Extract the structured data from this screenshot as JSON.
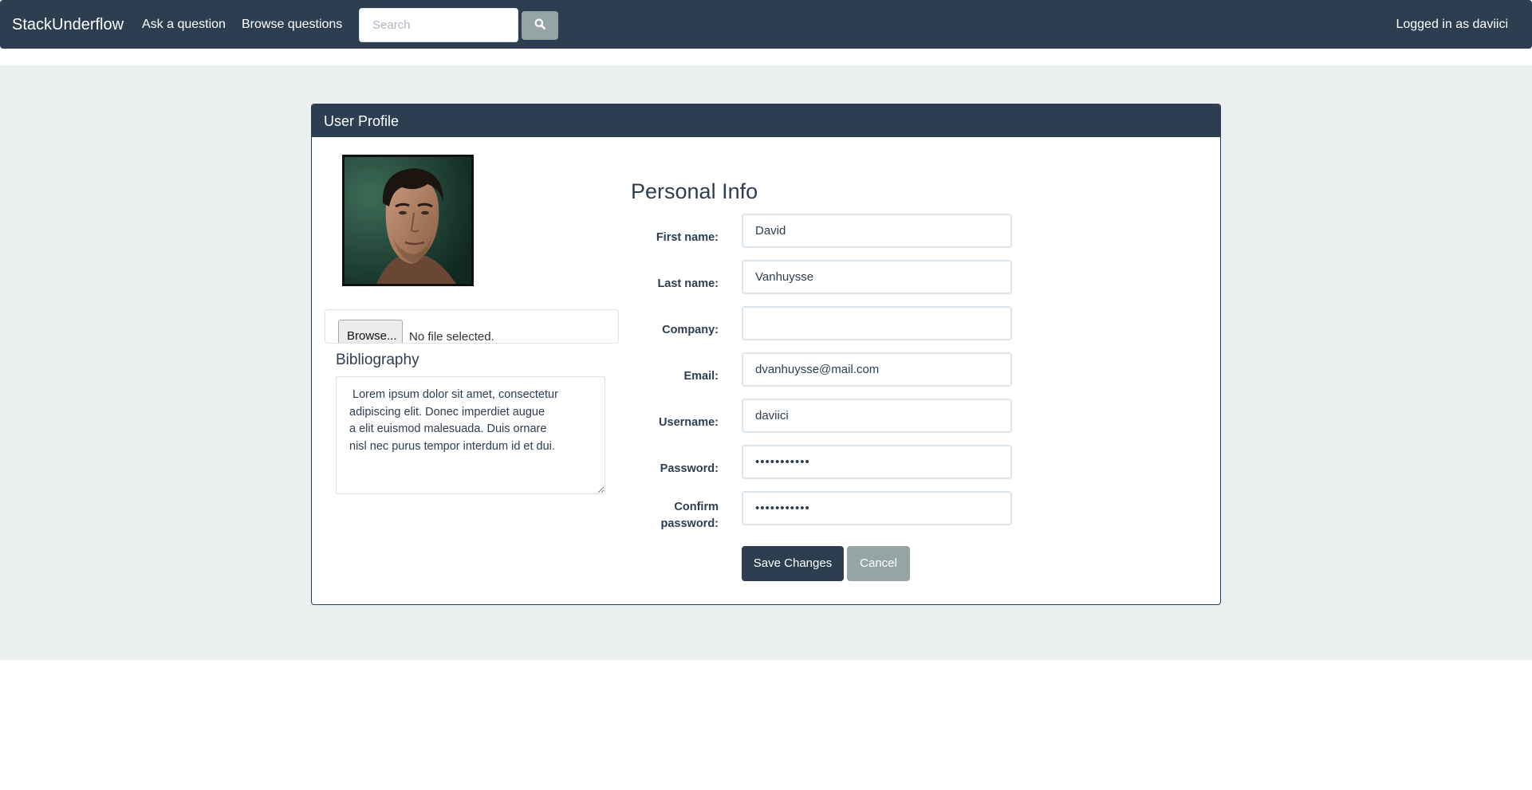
{
  "navbar": {
    "brand": "StackUnderflow",
    "ask_label": "Ask a question",
    "browse_label": "Browse questions",
    "search_placeholder": "Search",
    "search_icon": "search-icon",
    "logged_in_text": "Logged in as daviici"
  },
  "panel": {
    "title": "User Profile"
  },
  "avatar": {
    "icon": "user-avatar-photo"
  },
  "file_upload": {
    "button_label": "Browse...",
    "status": "No file selected."
  },
  "bio": {
    "label": "Bibliography",
    "text": " Lorem ipsum dolor sit amet, consectetur\nadipiscing elit. Donec imperdiet augue\na elit euismod malesuada. Duis ornare\nnisl nec purus tempor interdum id et dui."
  },
  "personal_info": {
    "title": "Personal Info",
    "fields": {
      "first_name": {
        "label": "First name:",
        "value": "David"
      },
      "last_name": {
        "label": "Last name:",
        "value": "Vanhuysse"
      },
      "company": {
        "label": "Company:",
        "value": ""
      },
      "email": {
        "label": "Email:",
        "value": "dvanhuysse@mail.com"
      },
      "username": {
        "label": "Username:",
        "value": "daviici"
      },
      "password": {
        "label": "Password:",
        "value": "•••••••••••"
      },
      "confirm_password": {
        "label_line1": "Confirm",
        "label_line2": "password:",
        "value": "•••••••••••"
      }
    }
  },
  "actions": {
    "save_label": "Save Changes",
    "cancel_label": "Cancel"
  },
  "colors": {
    "primary": "#2c3e50",
    "secondary": "#95a5a6",
    "background_band": "#ecf0f1",
    "input_border": "#dce4ec"
  }
}
